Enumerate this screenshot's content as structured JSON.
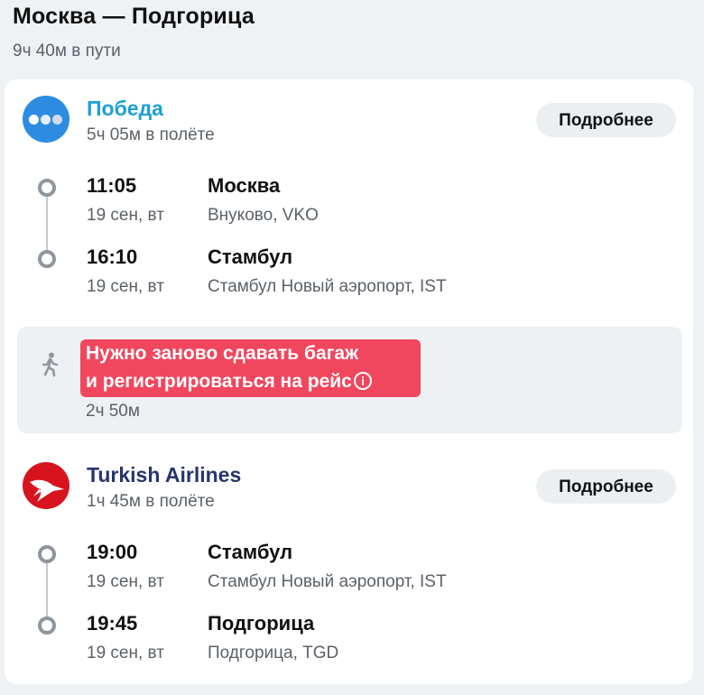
{
  "route": {
    "title": "Москва — Подгорица",
    "total_duration": "9ч 40м в пути"
  },
  "segments": [
    {
      "airline": "Победа",
      "airline_color": "#1da0d6",
      "logo_icon": "pobeda-logo-icon",
      "flight_duration": "5ч 05м в полёте",
      "details_label": "Подробнее",
      "departure": {
        "time": "11:05",
        "date": "19 сен, вт",
        "city": "Москва",
        "airport": "Внуково, VKO"
      },
      "arrival": {
        "time": "16:10",
        "date": "19 сен, вт",
        "city": "Стамбул",
        "airport": "Стамбул Новый аэропорт, IST"
      }
    },
    {
      "airline": "Turkish Airlines",
      "airline_color": "#27356e",
      "logo_icon": "turkish-airlines-logo-icon",
      "flight_duration": "1ч 45м в полёте",
      "details_label": "Подробнее",
      "departure": {
        "time": "19:00",
        "date": "19 сен, вт",
        "city": "Стамбул",
        "airport": "Стамбул Новый аэропорт, IST"
      },
      "arrival": {
        "time": "19:45",
        "date": "19 сен, вт",
        "city": "Подгорица",
        "airport": "Подгорица, TGD"
      }
    }
  ],
  "transfer": {
    "icon": "walking-person-icon",
    "warning_line1": "Нужно заново сдавать багаж",
    "warning_line2": "и регистрироваться на рейс",
    "warning_color": "#f0475e",
    "layover_duration": "2ч 50м"
  }
}
